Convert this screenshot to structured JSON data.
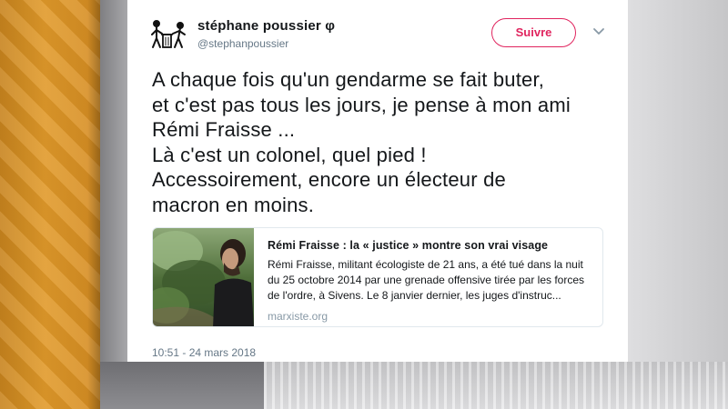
{
  "tweet": {
    "author": {
      "display_name": "stéphane poussier φ",
      "handle": "@stephanpoussier"
    },
    "follow_label": "Suivre",
    "text_lines": [
      "A chaque fois qu'un gendarme se fait buter,",
      "et c'est pas tous les jours, je pense à mon ami",
      "Rémi Fraisse ...",
      "Là c'est un colonel, quel pied !",
      "Accessoirement, encore un électeur de",
      "macron en moins."
    ],
    "card": {
      "title": "Rémi Fraisse : la « justice » montre son vrai visage",
      "description_lines": [
        "Rémi Fraisse, militant écologiste de 21 ans, a été tué dans la nuit",
        "du 25 octobre 2014 par une grenade offensive tirée par les forces",
        "de l'ordre, à Sivens. Le 8 janvier dernier, les juges d'instruc..."
      ],
      "domain": "marxiste.org"
    },
    "timestamp": "10:51 - 24 mars 2018"
  },
  "colors": {
    "follow_accent": "#e0245e",
    "text_primary": "#14171a",
    "text_secondary": "#657786",
    "card_border": "#e1e8ed",
    "background_orange": "#e19a2a"
  },
  "icons": {
    "avatar": "stick-figures-trash-avatar-icon",
    "menu": "chevron-down-icon"
  }
}
